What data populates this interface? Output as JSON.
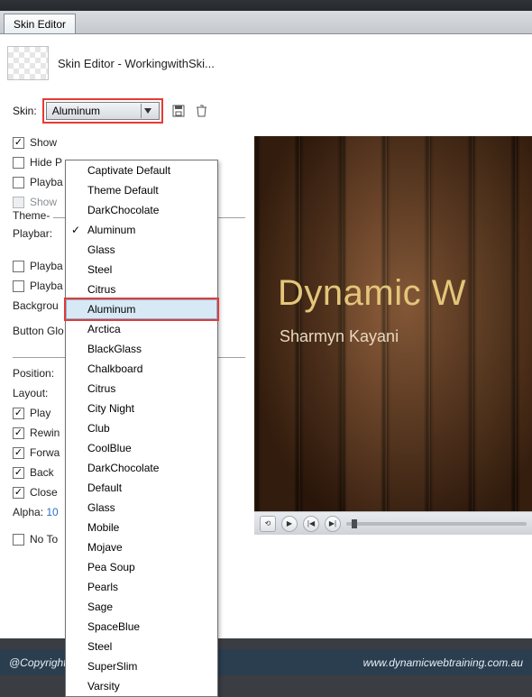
{
  "tab": {
    "label": "Skin Editor"
  },
  "header": {
    "title": "Skin Editor - WorkingwithSki..."
  },
  "skin": {
    "label": "Skin:",
    "selected": "Aluminum",
    "options": [
      "Captivate Default",
      "Theme Default",
      "DarkChocolate",
      "Aluminum",
      "Glass",
      "Steel",
      "Citrus",
      "Aluminum",
      "Arctica",
      "BlackGlass",
      "Chalkboard",
      "Citrus",
      "City Night",
      "Club",
      "CoolBlue",
      "DarkChocolate",
      "Default",
      "Glass",
      "Mobile",
      "Mojave",
      "Pea Soup",
      "Pearls",
      "Sage",
      "SpaceBlue",
      "Steel",
      "SuperSlim",
      "Varsity"
    ],
    "checked_index": 3,
    "highlight_index": 7
  },
  "left": {
    "show": "Show",
    "hidep": "Hide P",
    "playba": "Playba",
    "showg": "Show",
    "theme_legend": "Theme-",
    "playbars": "Playbar:",
    "playba2": "Playba",
    "playba3": "Playba",
    "background": "Backgrou",
    "buttonglo": "Button Glo",
    "position": "Position:",
    "layout": "Layout:",
    "play": "Play",
    "rewin": "Rewin",
    "forwa": "Forwa",
    "back": "Back",
    "close": "Close",
    "alpha": "Alpha:",
    "alpha_val": "10",
    "noto": "No To"
  },
  "preview": {
    "title": "Dynamic W",
    "subtitle": "Sharmyn Kayani"
  },
  "footer": {
    "left": "@Copyright:",
    "right": "www.dynamicwebtraining.com.au"
  },
  "plank_colors": [
    "#6f3e1d",
    "#5a2e14",
    "#7a4423",
    "#67381b",
    "#5e3116",
    "#6a3c1c",
    "#76421f"
  ]
}
